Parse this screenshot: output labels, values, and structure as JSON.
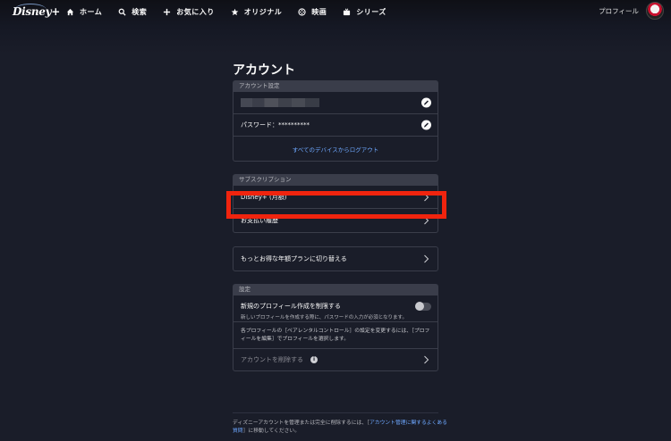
{
  "nav": {
    "logo_text": "Disney+",
    "items": [
      {
        "label": "ホーム",
        "icon": "home-icon"
      },
      {
        "label": "検索",
        "icon": "search-icon"
      },
      {
        "label": "お気に入り",
        "icon": "plus-icon"
      },
      {
        "label": "オリジナル",
        "icon": "star-icon"
      },
      {
        "label": "映画",
        "icon": "movie-icon"
      },
      {
        "label": "シリーズ",
        "icon": "tv-icon"
      }
    ],
    "profile_label": "プロフィール"
  },
  "account": {
    "title": "アカウント",
    "settings_header": "アカウント設定",
    "password_label": "パスワード：**********",
    "logout_all_label": "すべてのデバイスからログアウト"
  },
  "subscription": {
    "header": "サブスクリプション",
    "plan_label": "Disney+ (月額)",
    "payment_history_label": "お支払い履歴",
    "switch_plan_label": "もっとお得な年額プランに切り替える"
  },
  "settings": {
    "header": "設定",
    "restrict_title": "新規のプロフィール作成を制限する",
    "restrict_sub": "新しいプロフィールを作成する際に、パスワードの入力が必須となります。",
    "restrict_enabled": false,
    "parental_text": "各プロフィールの［ペアレンタルコントロール］の設定を変更するには、［プロフィールを編集］でプロフィールを選択します。",
    "delete_account_label": "アカウントを削除する"
  },
  "footer": {
    "text_before": "ディズニーアカウントを管理または完全に削除するには、［",
    "link_text": "アカウント管理に関するよくある質問",
    "text_after": "］に移動してください。"
  },
  "colors": {
    "background": "#1a1d29",
    "section_header": "#3a3d4a",
    "link": "#6ea8ff",
    "highlight": "#f0240e"
  }
}
